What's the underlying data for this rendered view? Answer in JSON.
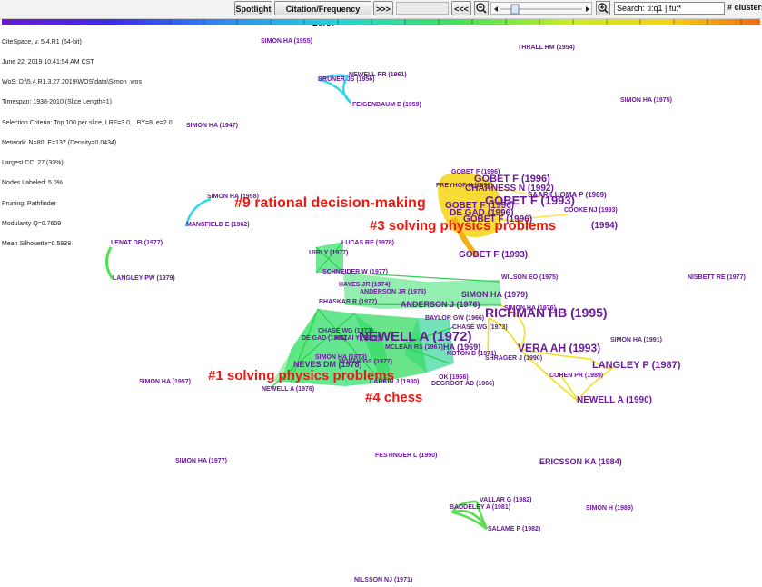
{
  "toolbar": {
    "spotlight": "Spotlight",
    "burst": "Citation/Frequency Burst",
    "forward": ">>>",
    "back": "<<<",
    "search_value": "Search: ti:q1 | fu:*",
    "clusters_label": "# clusters"
  },
  "info": [
    "CiteSpace, v. 5.4.R1 (64-bit)",
    "June 22, 2019 10:41:54 AM CST",
    "WoS: D:\\5.4.R1.3.27.2019\\WOS\\data\\Simon_wos",
    "Timespan: 1938-2010 (Slice Length=1)",
    "Selection Criteria: Top 100 per slice, LRF=3.0, LBY=8, e=2.0",
    "Network: N=80, E=137 (Density=0.0434)",
    "Largest CC: 27 (33%)",
    "Nodes Labeled: 5.0%",
    "Pruning: Pathfinder",
    "Modularity Q=0.7609",
    "Mean Silhouette=0.5838"
  ],
  "clusters": [
    {
      "id": "c9",
      "label": "#9 rational decision-making"
    },
    {
      "id": "c3",
      "label": "#3 solving physics problems"
    },
    {
      "id": "c1",
      "label": "#1 solving physics problems"
    },
    {
      "id": "c4",
      "label": "#4 chess"
    }
  ],
  "nodes": [
    "SIMON HA (1955)",
    "THRALL RM (1954)",
    "NEWELL RR (1961)",
    "BRUNER JS (1956)",
    "FEIGENBAUM E (1959)",
    "SIMON HA (1975)",
    "SIMON HA (1947)",
    "GOBET F (1996)",
    "GOBET F (1996)",
    "CHARNESS N (1992)",
    "FREYHOF H (1992)",
    "GOBET F (1993)",
    "SAARILUOMA P (1989)",
    "GOBET F (1996)",
    "DE GAD (1996)",
    "COOKE NJ (1993)",
    "GOBET F (1996)",
    "(1994)",
    "SIMON HA (1958)",
    "MANSFIELD E (1962)",
    "LENAT DB (1977)",
    "LANGLEY PW (1979)",
    "LUCAS RE (1978)",
    "IJIRI Y (1977)",
    "GOBET F (1993)",
    "SCHNEIDER W (1977)",
    "WILSON EO (1975)",
    "NISBETT RE (1977)",
    "HAYES JR (1974)",
    "ANDERSON JR (1973)",
    "SIMON HA (1979)",
    "BHASKAR R (1977)",
    "ANDERSON J (1976)",
    "SIMON HA (1976)",
    "RICHMAN HB (1995)",
    "BAYLOR GW (1966)",
    "CHASE WG (1973)",
    "CHASE WG (1973)",
    "NEWELL A (1972)",
    "DE GAD (1965)",
    "ANZAI Y (1979)",
    "SIMON HA (1991)",
    "MCLEAN RS (1967)",
    "HA (1969)",
    "NOTON D (1971)",
    "VERA AH (1993)",
    "SHRAGER J (1990)",
    "SIMON HA (1973)",
    "NOVAK GS (1977)",
    "NEVES DM (1978)",
    "LANGLEY P (1987)",
    "COHEN PR (1989)",
    "SIMON HA (1957)",
    "LARKIN J (1980)",
    "OK (1966)",
    "DEGROOT AD (1966)",
    "NEWELL A (1976)",
    "NEWELL A (1990)",
    "SIMON HA (1977)",
    "FESTINGER L (1950)",
    "ERICSSON KA (1984)",
    "VALLAR G (1982)",
    "BADDELEY A (1981)",
    "SIMON H (1989)",
    "SALAME P (1982)",
    "NILSSON NJ (1971)"
  ]
}
